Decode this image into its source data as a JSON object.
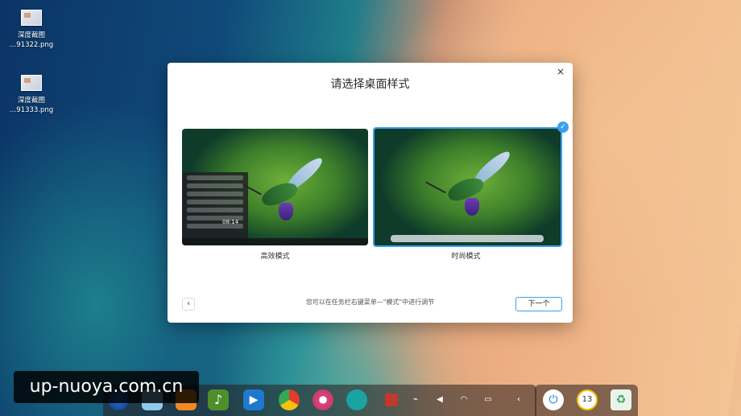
{
  "desktop": {
    "icons": [
      {
        "label_line1": "深度截图",
        "label_line2": "…91322.png"
      },
      {
        "label_line1": "深度截图",
        "label_line2": "…91333.png"
      }
    ]
  },
  "dialog": {
    "title": "请选择桌面样式",
    "close_glyph": "×",
    "options": [
      {
        "label": "高效模式",
        "selected": false
      },
      {
        "label": "时尚模式",
        "selected": true
      }
    ],
    "check_glyph": "✓",
    "prev_glyph": "‹",
    "hint": "您可以在任务栏右键菜单—\"模式\"中进行调节",
    "next_label": "下一个"
  },
  "preview_clock": "08:14",
  "tray": {
    "calendar_day": "13"
  },
  "watermark": "up-nuoya.com.cn",
  "colors": {
    "accent": "#3aa1ee"
  }
}
